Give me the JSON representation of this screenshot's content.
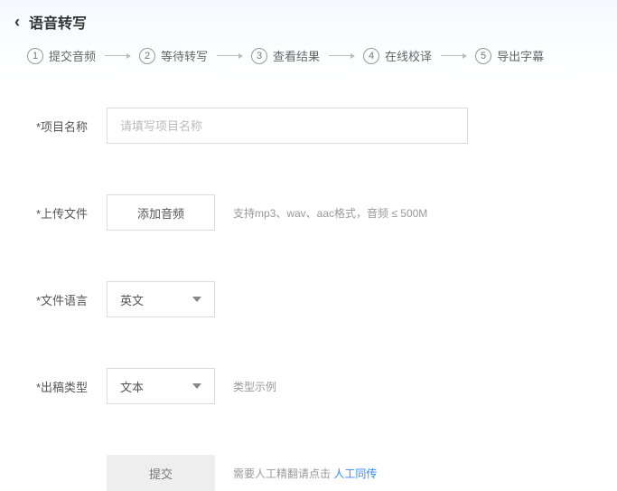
{
  "header": {
    "title": "语音转写"
  },
  "steps": [
    {
      "num": "1",
      "label": "提交音频"
    },
    {
      "num": "2",
      "label": "等待转写"
    },
    {
      "num": "3",
      "label": "查看结果"
    },
    {
      "num": "4",
      "label": "在线校译"
    },
    {
      "num": "5",
      "label": "导出字幕"
    }
  ],
  "form": {
    "projectName": {
      "label": "*项目名称",
      "placeholder": "请填写项目名称",
      "value": ""
    },
    "upload": {
      "label": "*上传文件",
      "button": "添加音频",
      "hint": "支持mp3、wav、aac格式，音频 ≤ 500M"
    },
    "language": {
      "label": "*文件语言",
      "selected": "英文"
    },
    "outputType": {
      "label": "*出稿类型",
      "selected": "文本",
      "hint": "类型示例"
    },
    "submit": {
      "button": "提交",
      "hint_prefix": "需要人工精翻请点击 ",
      "hint_link": "人工同传"
    }
  }
}
